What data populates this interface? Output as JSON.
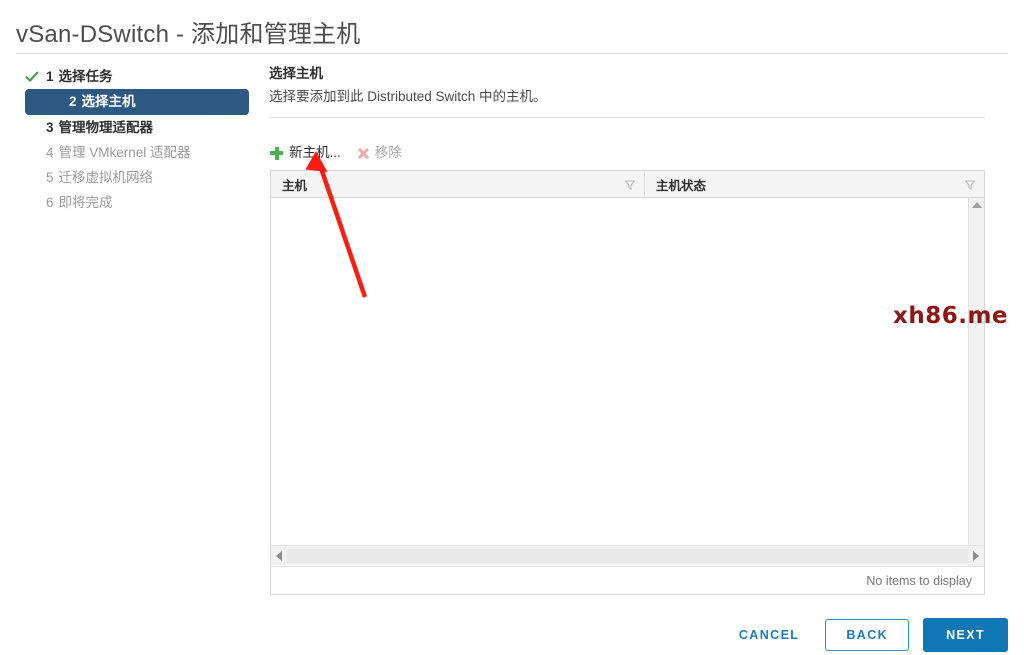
{
  "window": {
    "title": "vSan-DSwitch - 添加和管理主机"
  },
  "sidebar": {
    "steps": [
      {
        "num": "1",
        "label": "选择任务",
        "state": "done"
      },
      {
        "num": "2",
        "label": "选择主机",
        "state": "active"
      },
      {
        "num": "3",
        "label": "管理物理适配器",
        "state": "pending"
      },
      {
        "num": "4",
        "label": "管理 VMkernel 适配器",
        "state": "future"
      },
      {
        "num": "5",
        "label": "迁移虚拟机网络",
        "state": "future"
      },
      {
        "num": "6",
        "label": "即将完成",
        "state": "future"
      }
    ]
  },
  "main": {
    "section_title": "选择主机",
    "section_desc": "选择要添加到此 Distributed Switch 中的主机。"
  },
  "toolbar": {
    "add_host_label": "新主机...",
    "add_host_icon": "plus-icon",
    "remove_label": "移除",
    "remove_icon": "close-x-icon",
    "remove_disabled": true
  },
  "table": {
    "columns": [
      {
        "label": "主机",
        "filter_icon": "funnel-icon"
      },
      {
        "label": "主机状态",
        "filter_icon": "funnel-icon"
      }
    ],
    "rows": [],
    "empty_text": "No items to display"
  },
  "footer": {
    "cancel_label": "CANCEL",
    "back_label": "BACK",
    "next_label": "NEXT"
  },
  "overlay": {
    "watermark_text": "xh86.me",
    "watermark_color": "#8c1515",
    "arrow_color": "#fb1d12"
  },
  "colors": {
    "active_step_bg": "#2d5882",
    "primary_button": "#0f77b4",
    "link_blue": "#1c7cb5",
    "plus_green": "#4caf50",
    "check_green": "#46a046"
  }
}
